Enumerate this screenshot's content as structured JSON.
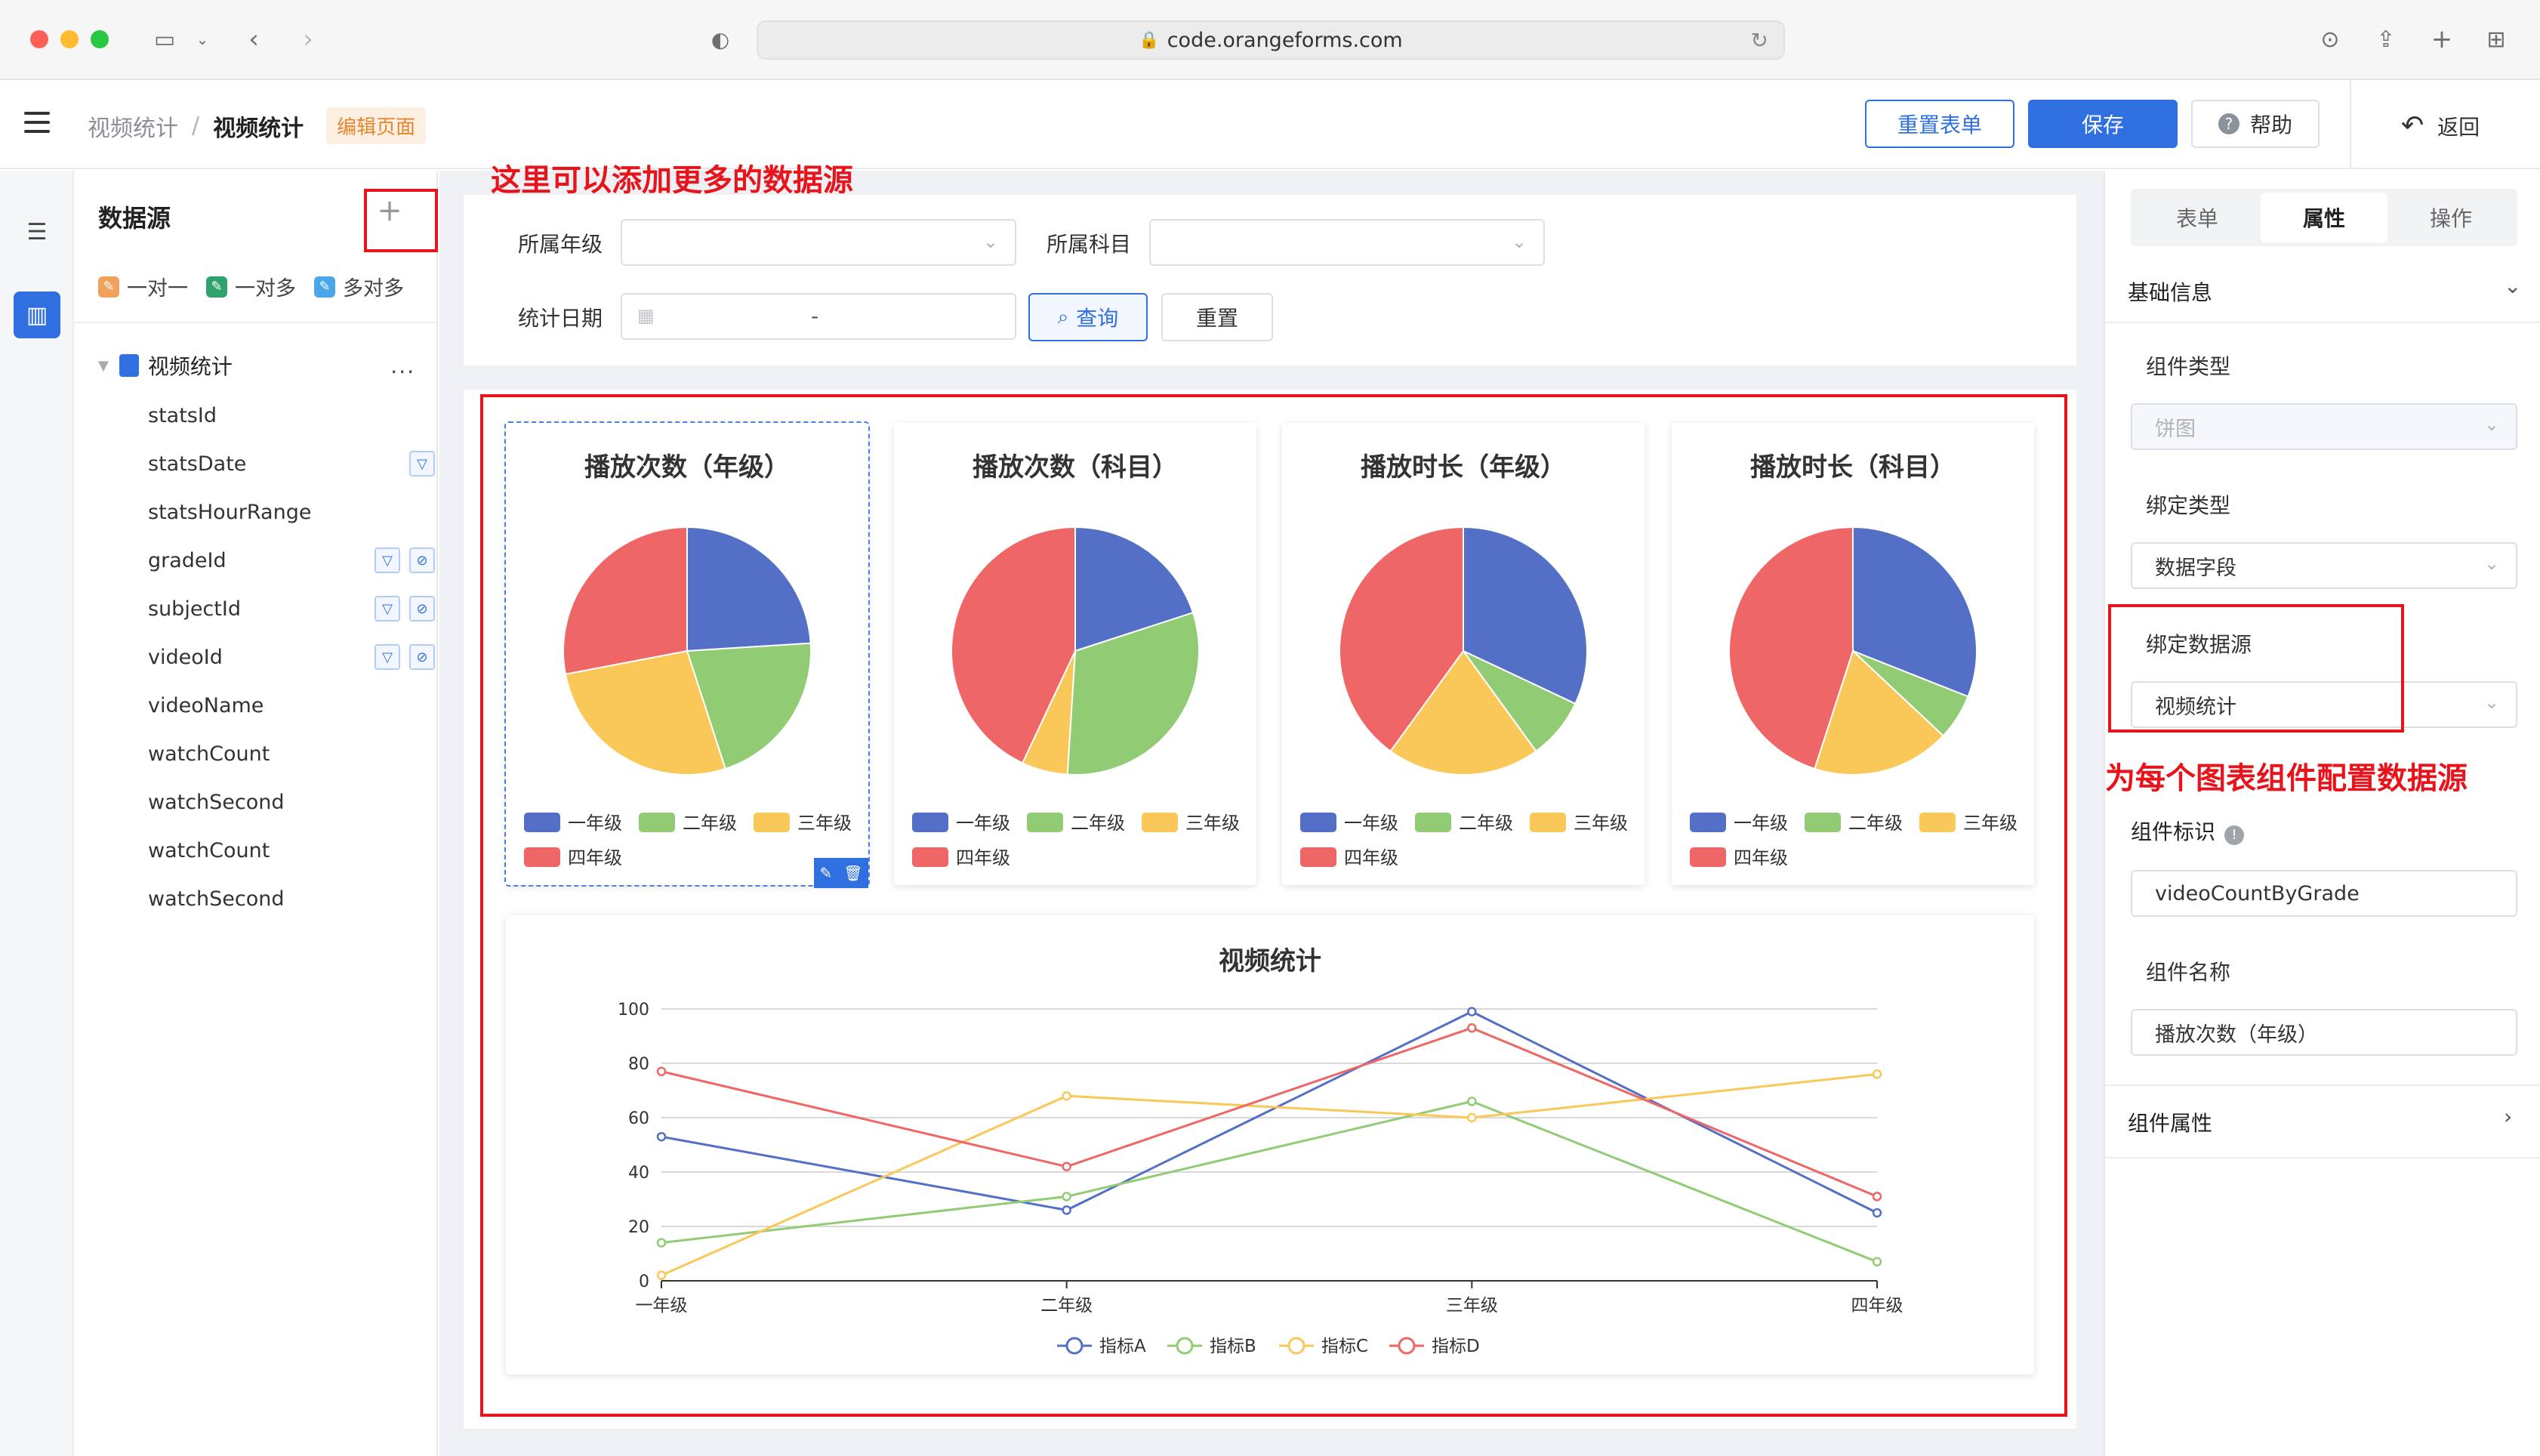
{
  "browser": {
    "url": "code.orangeforms.com"
  },
  "header": {
    "breadcrumb_parent": "视频统计",
    "breadcrumb_sep": "/",
    "breadcrumb_current": "视频统计",
    "edit_tag": "编辑页面",
    "reset_form": "重置表单",
    "save": "保存",
    "help": "帮助",
    "back": "返回"
  },
  "datasource": {
    "title": "数据源",
    "add_symbol": "+",
    "relations": [
      "一对一",
      "一对多",
      "多对多"
    ],
    "root": "视频统计",
    "more": "...",
    "fields": [
      "statsId",
      "statsDate",
      "statsHourRange",
      "gradeId",
      "subjectId",
      "videoId",
      "videoName",
      "watchCount",
      "watchSecond",
      "watchCount",
      "watchSecond"
    ]
  },
  "filter": {
    "grade_label": "所属年级",
    "subject_label": "所属科目",
    "date_label": "统计日期",
    "date_sep": "-",
    "query": "查询",
    "reset": "重置"
  },
  "chart_data": [
    {
      "type": "pie",
      "title": "播放次数（年级）",
      "categories": [
        "一年级",
        "二年级",
        "三年级",
        "四年级"
      ],
      "values": [
        24,
        21,
        27,
        28
      ]
    },
    {
      "type": "pie",
      "title": "播放次数（科目）",
      "categories": [
        "一年级",
        "二年级",
        "三年级",
        "四年级"
      ],
      "values": [
        20,
        31,
        6,
        43
      ]
    },
    {
      "type": "pie",
      "title": "播放时长（年级）",
      "categories": [
        "一年级",
        "二年级",
        "三年级",
        "四年级"
      ],
      "values": [
        32,
        8,
        20,
        40
      ]
    },
    {
      "type": "pie",
      "title": "播放时长（科目）",
      "categories": [
        "一年级",
        "二年级",
        "三年级",
        "四年级"
      ],
      "values": [
        31,
        6,
        18,
        45
      ]
    },
    {
      "type": "line",
      "title": "视频统计",
      "categories": [
        "一年级",
        "二年级",
        "三年级",
        "四年级"
      ],
      "ylim": [
        0,
        100
      ],
      "yticks": [
        0,
        20,
        40,
        60,
        80,
        100
      ],
      "grid": true,
      "legend": "bottom",
      "series": [
        {
          "name": "指标A",
          "values": [
            53,
            26,
            99,
            25
          ]
        },
        {
          "name": "指标B",
          "values": [
            14,
            31,
            66,
            7
          ]
        },
        {
          "name": "指标C",
          "values": [
            2,
            68,
            60,
            76
          ]
        },
        {
          "name": "指标D",
          "values": [
            77,
            42,
            93,
            31
          ]
        }
      ]
    }
  ],
  "colors": {
    "s1": "#5470c6",
    "s2": "#91cc75",
    "s3": "#fac858",
    "s4": "#ee6666",
    "accent": "#2f6fe0",
    "annotation": "#e8141c"
  },
  "right_panel": {
    "tabs": [
      "表单",
      "属性",
      "操作"
    ],
    "basic_info": "基础信息",
    "component_type_label": "组件类型",
    "component_type_value": "饼图",
    "bind_type_label": "绑定类型",
    "bind_type_value": "数据字段",
    "bind_source_label": "绑定数据源",
    "bind_source_value": "视频统计",
    "component_id_label": "组件标识",
    "component_id_value": "videoCountByGrade",
    "component_name_label": "组件名称",
    "component_name_value": "播放次数（年级）",
    "component_props": "组件属性"
  },
  "annotations": {
    "add_more": "这里可以添加更多的数据源",
    "config_each": "为每个图表组件配置数据源"
  }
}
